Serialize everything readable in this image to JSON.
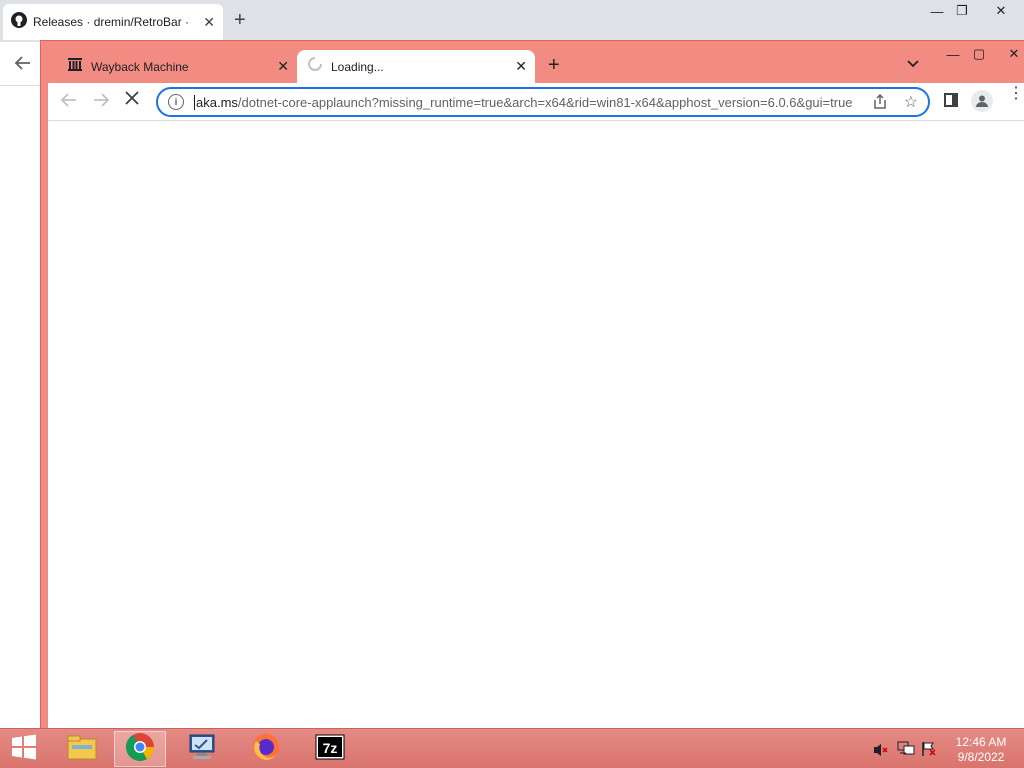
{
  "background_window": {
    "tab": {
      "title": "Releases · dremin/RetroBar · GitHub",
      "icon": "github-icon"
    },
    "controls": {
      "minimize": "—",
      "maximize": "❐",
      "close": "✕"
    }
  },
  "foreground_window": {
    "tabs": [
      {
        "title": "Wayback Machine",
        "icon": "archive-icon"
      },
      {
        "title": "Loading...",
        "icon": "loading-spinner-icon"
      }
    ],
    "new_tab_label": "+",
    "omnibox": {
      "domain": "aka.ms",
      "path": "/dotnet-core-applaunch?missing_runtime=true&arch=x64&rid=win81-x64&apphost_version=6.0.6&gui=true"
    },
    "controls": {
      "minimize": "—",
      "maximize": "▢",
      "close": "✕"
    }
  },
  "taskbar": {
    "apps": [
      "start-icon",
      "file-explorer-icon",
      "chrome-icon",
      "admin-tools-icon",
      "firefox-icon",
      "7zip-icon"
    ],
    "seven_zip_label": "7z",
    "tray": {
      "time": "12:46 AM",
      "date": "9/8/2022"
    }
  },
  "colors": {
    "accent": "#f28b82",
    "omnibox_focus": "#1a73e8",
    "taskbar": "#e58a84"
  }
}
